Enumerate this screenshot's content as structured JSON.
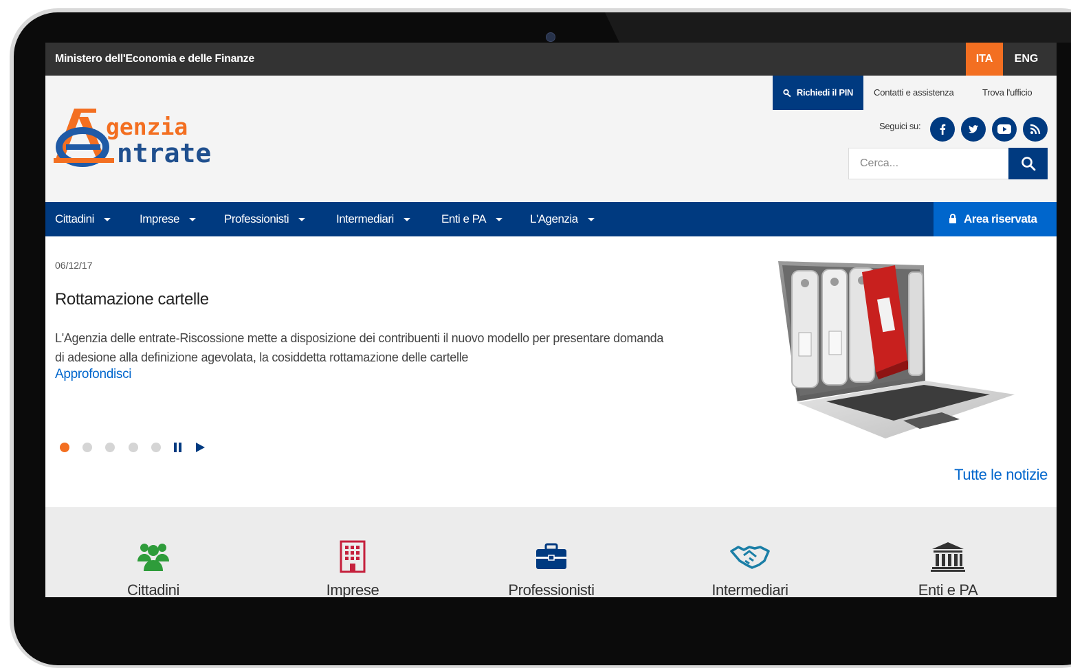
{
  "topbar": {
    "ministry": "Ministero dell'Economia e delle Finanze",
    "languages": [
      "ITA",
      "ENG"
    ],
    "active_language": "ITA"
  },
  "header": {
    "logo_line1": "genzia",
    "logo_line2": "ntrate",
    "pin_label": "Richiedi il PIN",
    "contacts_label": "Contatti e assistenza",
    "office_label": "Trova l'ufficio",
    "follow_label": "Seguici su:",
    "social": [
      "facebook-icon",
      "twitter-icon",
      "youtube-icon",
      "rss-icon"
    ],
    "search_placeholder": "Cerca..."
  },
  "nav": {
    "items": [
      "Cittadini",
      "Imprese",
      "Professionisti",
      "Intermediari",
      "Enti e PA",
      "L'Agenzia"
    ],
    "reserved_area": "Area riservata"
  },
  "hero": {
    "date": "06/12/17",
    "title": "Rottamazione cartelle",
    "description": "L'Agenzia delle entrate-Riscossione mette a disposizione dei contribuenti il nuovo modello per presentare domanda di adesione alla definizione agevolata, la cosiddetta rottamazione delle cartelle",
    "read_more": "Approfondisci",
    "slides_total": 5,
    "active_slide": 1,
    "all_news": "Tutte le notizie"
  },
  "categories": [
    {
      "label": "Cittadini",
      "icon": "people-icon",
      "color": "#2e9c3a"
    },
    {
      "label": "Imprese",
      "icon": "building-icon",
      "color": "#c5203c"
    },
    {
      "label": "Professionisti",
      "icon": "briefcase-icon",
      "color": "#003a80"
    },
    {
      "label": "Intermediari",
      "icon": "handshake-icon",
      "color": "#1a7ea6"
    },
    {
      "label": "Enti e PA",
      "icon": "institution-icon",
      "color": "#333333"
    }
  ],
  "colors": {
    "primary": "#003a80",
    "accent": "#f36f21",
    "link": "#0066cc",
    "topbar": "#333333"
  }
}
